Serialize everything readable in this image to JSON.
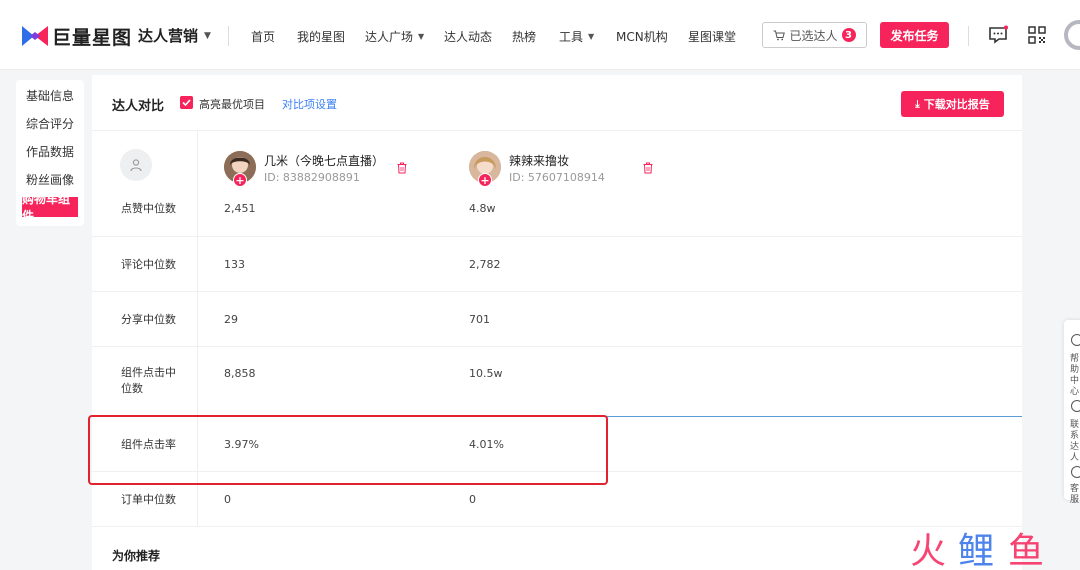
{
  "header": {
    "brand": "巨量星图",
    "sub_brand": "达人营销",
    "nav": [
      "首页",
      "我的星图",
      "达人广场",
      "达人动态",
      "热榜",
      "工具",
      "MCN机构",
      "星图课堂"
    ],
    "selected_label": "已选达人",
    "selected_count": "3",
    "publish_label": "发布任务",
    "brand_color": "#f6245b"
  },
  "side_menu": {
    "items": [
      "基础信息",
      "综合评分",
      "作品数据",
      "粉丝画像",
      "购物车组件"
    ],
    "active_index": 4
  },
  "compare": {
    "title": "达人对比",
    "highlight_label": "高亮最优项目",
    "highlight_checked": true,
    "settings_link": "对比项设置",
    "download_label": "下载对比报告"
  },
  "kols": [
    {
      "name": "几米（今晚七点直播）",
      "id": "ID: 83882908891"
    },
    {
      "name": "辣辣来撸妆",
      "id": "ID: 57607108914"
    }
  ],
  "rows": [
    {
      "label": "点赞中位数",
      "v1": "2,451",
      "v2": "4.8w"
    },
    {
      "label": "评论中位数",
      "v1": "133",
      "v2": "2,782"
    },
    {
      "label": "分享中位数",
      "v1": "29",
      "v2": "701"
    },
    {
      "label": "组件点击中位数",
      "v1": "8,858",
      "v2": "10.5w"
    },
    {
      "label": "组件点击率",
      "v1": "3.97%",
      "v2": "4.01%"
    },
    {
      "label": "订单中位数",
      "v1": "0",
      "v2": "0"
    }
  ],
  "recommend_title": "为你推荐",
  "right_tools": [
    "帮助中心",
    "联系达人",
    "客服"
  ]
}
